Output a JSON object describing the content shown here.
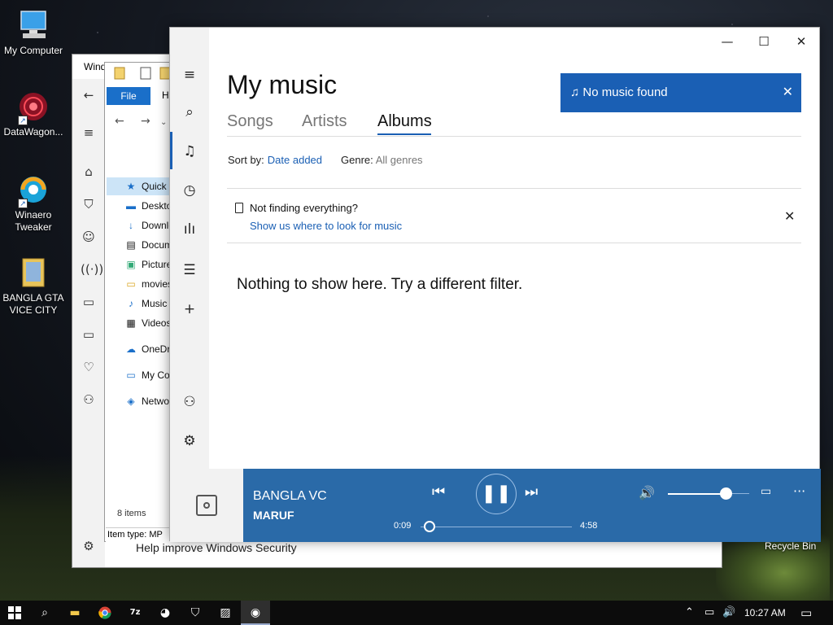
{
  "desktop": {
    "icons": [
      {
        "label": "My Computer",
        "icon": "computer-icon"
      },
      {
        "label": "DataWagon...",
        "icon": "datawagon-icon"
      },
      {
        "label": "Winaero Tweaker",
        "icon": "winaero-icon"
      },
      {
        "label": "BANGLA GTA VICE CITY",
        "icon": "folder-icon"
      }
    ],
    "recycle_bin": "Recycle Bin"
  },
  "security_window": {
    "title": "Wind",
    "bottom_text": "Help improve Windows Security"
  },
  "explorer": {
    "file_tab": "File",
    "home_tab": "H",
    "nav_items": [
      {
        "label": "Quick access",
        "icon": "★"
      },
      {
        "label": "Desktop",
        "icon": "▬"
      },
      {
        "label": "Downloads",
        "icon": "↓"
      },
      {
        "label": "Documents",
        "icon": "▤"
      },
      {
        "label": "Pictures",
        "icon": "▣"
      },
      {
        "label": "movies",
        "icon": "▭"
      },
      {
        "label": "Music",
        "icon": "♪"
      },
      {
        "label": "Videos",
        "icon": "▦"
      },
      {
        "label": "OneDrive",
        "icon": "☁"
      },
      {
        "label": "My Computer",
        "icon": "▭"
      },
      {
        "label": "Network",
        "icon": "◈"
      }
    ],
    "item_count": "8 items",
    "status": "Item type: MP"
  },
  "groove": {
    "title": "My music",
    "tabs": [
      {
        "label": "Songs",
        "active": false
      },
      {
        "label": "Artists",
        "active": false
      },
      {
        "label": "Albums",
        "active": true
      }
    ],
    "sort_label": "Sort by:",
    "sort_value": "Date added",
    "genre_label": "Genre:",
    "genre_value": "All genres",
    "toast": "♫ No music found",
    "not_finding_title": "Not finding everything?",
    "not_finding_link": "Show us where to look for music",
    "empty_message": "Nothing to show here. Try a different filter.",
    "accent_color": "#1a5fb4",
    "player": {
      "song": "BANGLA VC",
      "artist": "MARUF",
      "elapsed": "0:09",
      "duration": "4:58",
      "progress_fraction": 0.03,
      "volume_fraction": 0.72
    }
  },
  "taskbar": {
    "clock": "10:27 AM"
  }
}
